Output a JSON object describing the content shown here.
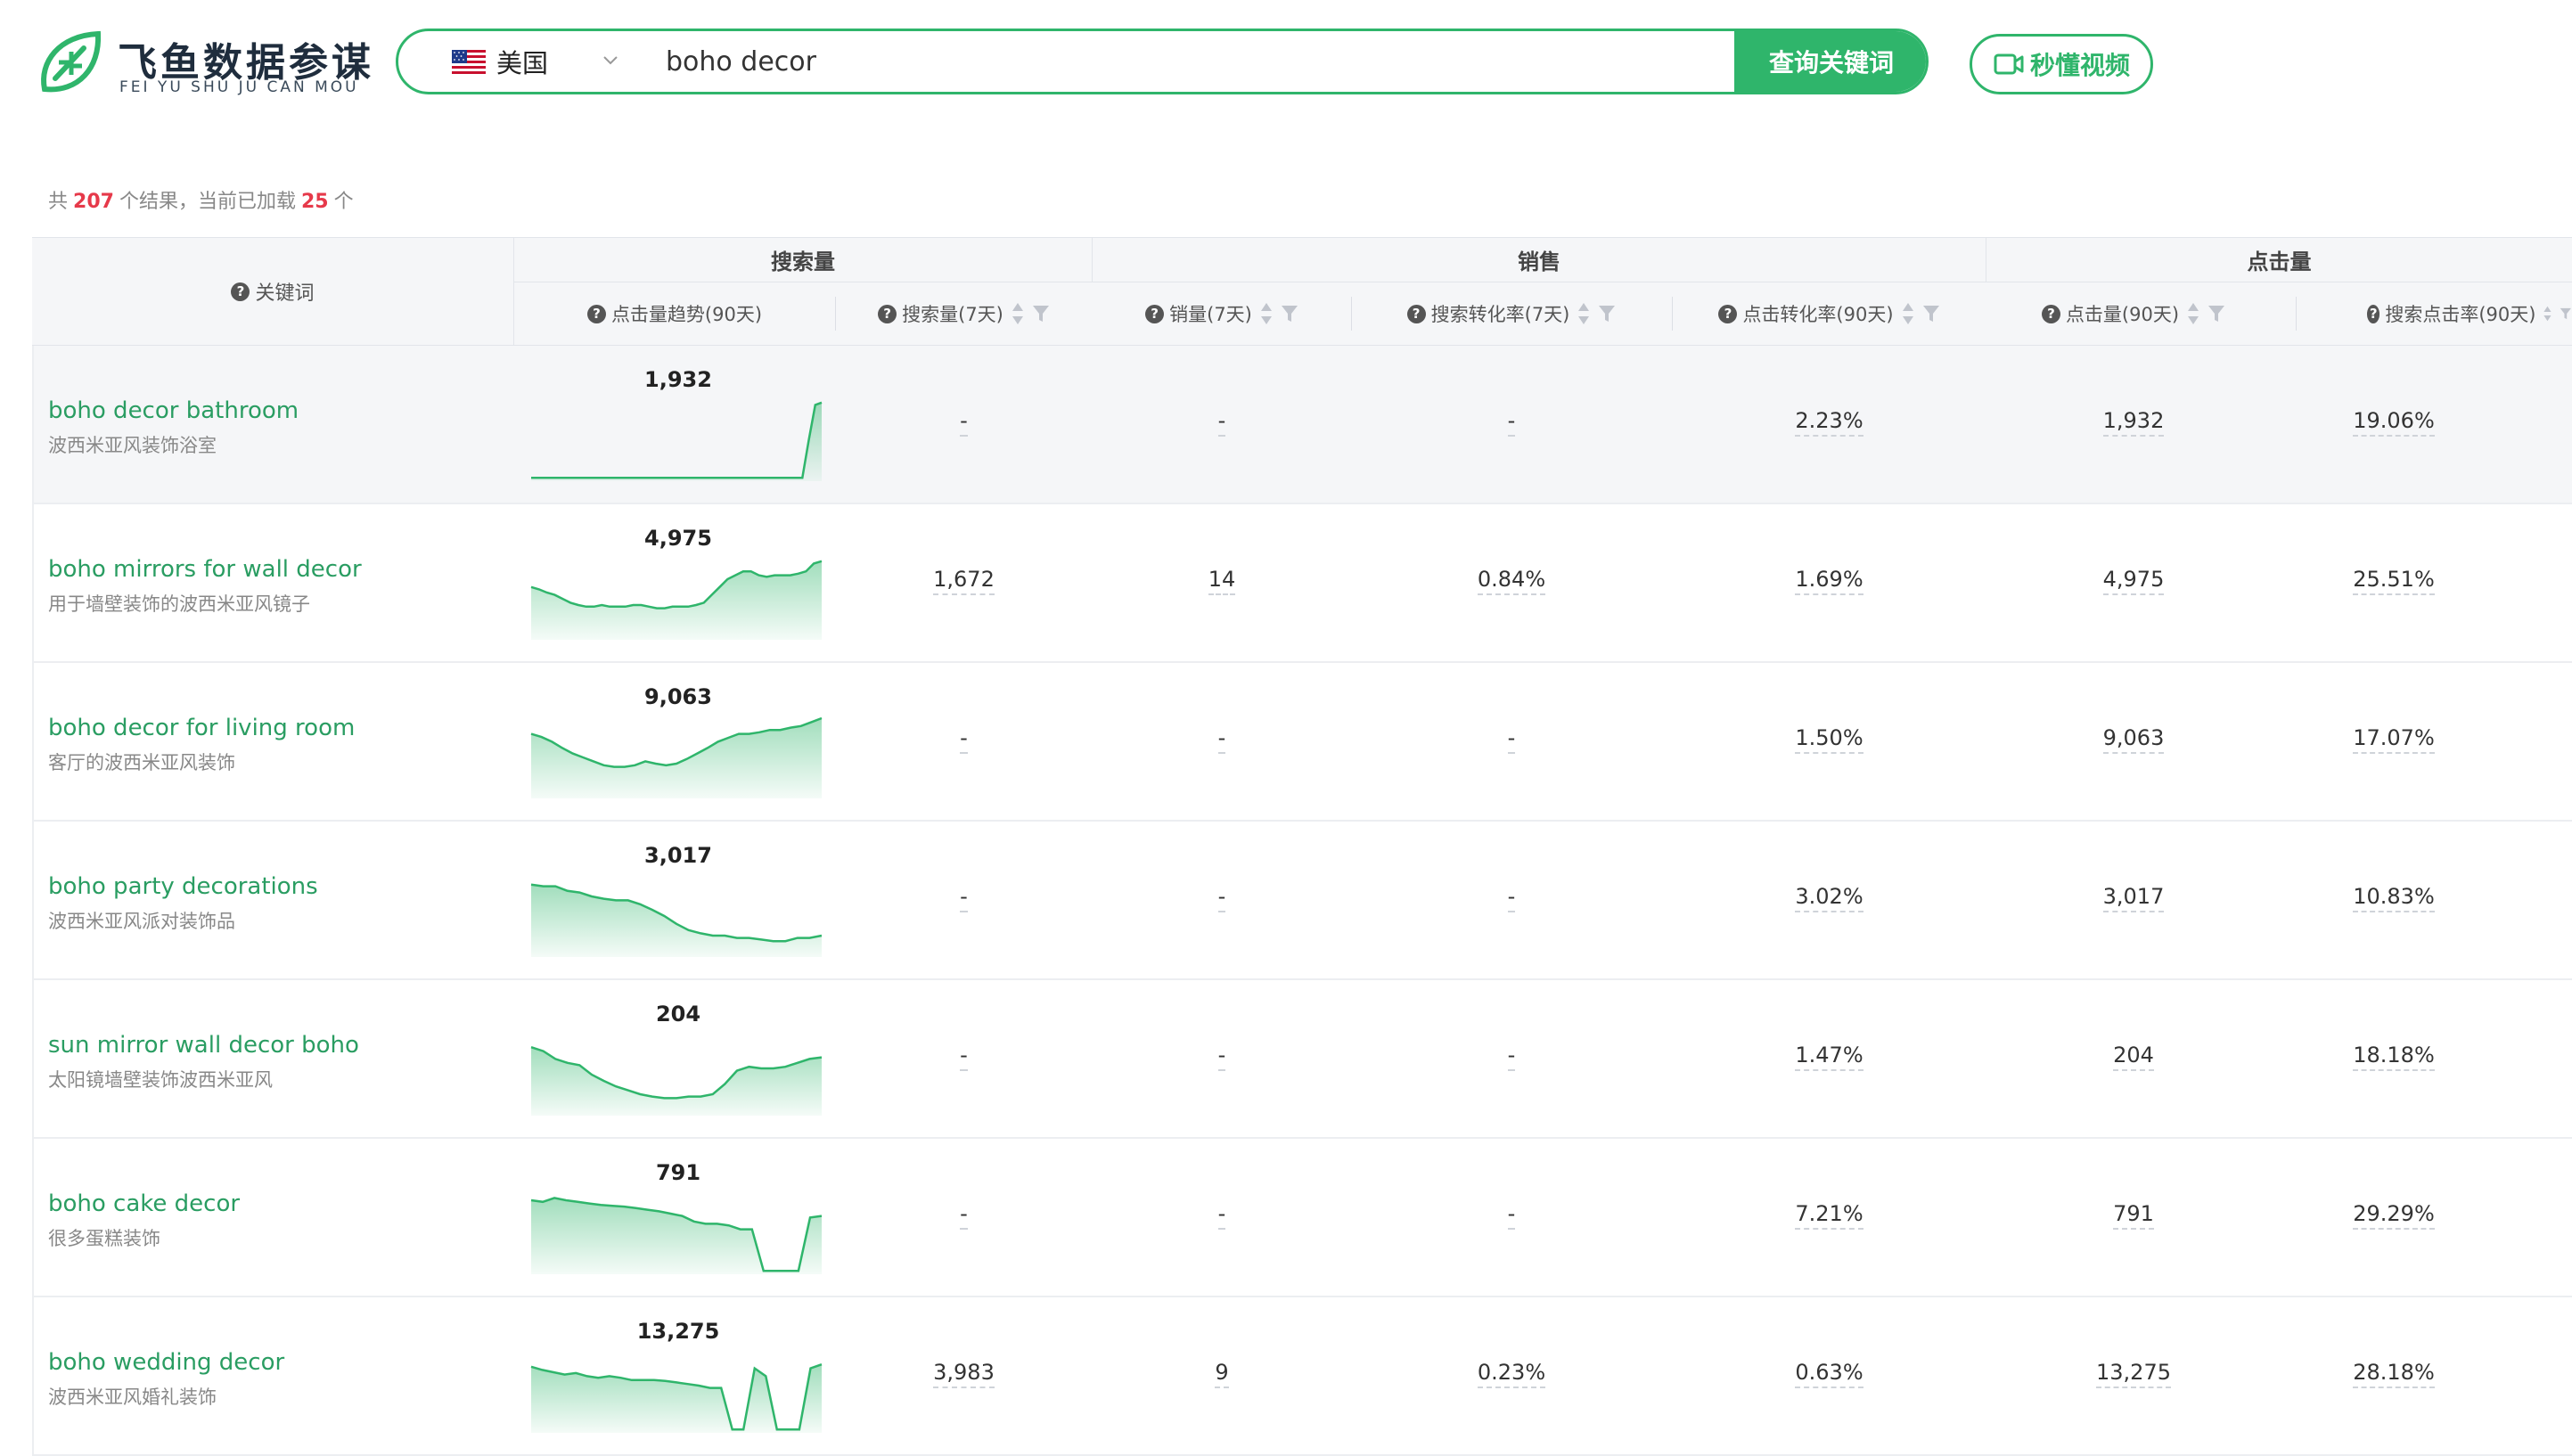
{
  "brand": {
    "name": "飞鱼数据参谋",
    "sub": "FEI YU SHU JU CAN MOU",
    "logo_icon": "rocket-leaf-logo"
  },
  "search": {
    "country": "美国",
    "country_flag": "us-flag-icon",
    "query": "boho decor",
    "button": "查询关键词",
    "accent": "#2fb56b"
  },
  "video_button": {
    "label": "秒懂视频",
    "icon": "video-camera-icon"
  },
  "summary": {
    "prefix": "共",
    "total": "207",
    "middle": "个结果，当前已加载",
    "loaded": "25",
    "suffix": "个"
  },
  "table": {
    "keyword_header": "关键词",
    "groups": {
      "search": "搜索量",
      "sales": "销售",
      "clicks": "点击量"
    },
    "columns": {
      "trend": "点击量趋势(90天)",
      "search7": "搜索量(7天)",
      "sales7": "销量(7天)",
      "conv7": "搜索转化率(7天)",
      "clickconv90": "点击转化率(90天)",
      "clicks90": "点击量(90天)",
      "ctr90": "搜索点击率(90天)"
    },
    "rows": [
      {
        "en": "boho decor bathroom",
        "cn": "波西米亚风装饰浴室",
        "trend_value": "1,932",
        "search7": "-",
        "sales7": "-",
        "conv7": "-",
        "clickconv90": "2.23%",
        "clicks90": "1,932",
        "ctr90": "19.06%"
      },
      {
        "en": "boho mirrors for wall decor",
        "cn": "用于墙壁装饰的波西米亚风镜子",
        "trend_value": "4,975",
        "search7": "1,672",
        "sales7": "14",
        "conv7": "0.84%",
        "clickconv90": "1.69%",
        "clicks90": "4,975",
        "ctr90": "25.51%"
      },
      {
        "en": "boho decor for living room",
        "cn": "客厅的波西米亚风装饰",
        "trend_value": "9,063",
        "search7": "-",
        "sales7": "-",
        "conv7": "-",
        "clickconv90": "1.50%",
        "clicks90": "9,063",
        "ctr90": "17.07%"
      },
      {
        "en": "boho party decorations",
        "cn": "波西米亚风派对装饰品",
        "trend_value": "3,017",
        "search7": "-",
        "sales7": "-",
        "conv7": "-",
        "clickconv90": "3.02%",
        "clicks90": "3,017",
        "ctr90": "10.83%"
      },
      {
        "en": "sun mirror wall decor boho",
        "cn": "太阳镜墙壁装饰波西米亚风",
        "trend_value": "204",
        "search7": "-",
        "sales7": "-",
        "conv7": "-",
        "clickconv90": "1.47%",
        "clicks90": "204",
        "ctr90": "18.18%"
      },
      {
        "en": "boho cake decor",
        "cn": "很多蛋糕装饰",
        "trend_value": "791",
        "search7": "-",
        "sales7": "-",
        "conv7": "-",
        "clickconv90": "7.21%",
        "clicks90": "791",
        "ctr90": "29.29%"
      },
      {
        "en": "boho wedding decor",
        "cn": "波西米亚风婚礼装饰",
        "trend_value": "13,275",
        "search7": "3,983",
        "sales7": "9",
        "conv7": "0.23%",
        "clickconv90": "0.63%",
        "clicks90": "13,275",
        "ctr90": "28.18%"
      }
    ]
  }
}
